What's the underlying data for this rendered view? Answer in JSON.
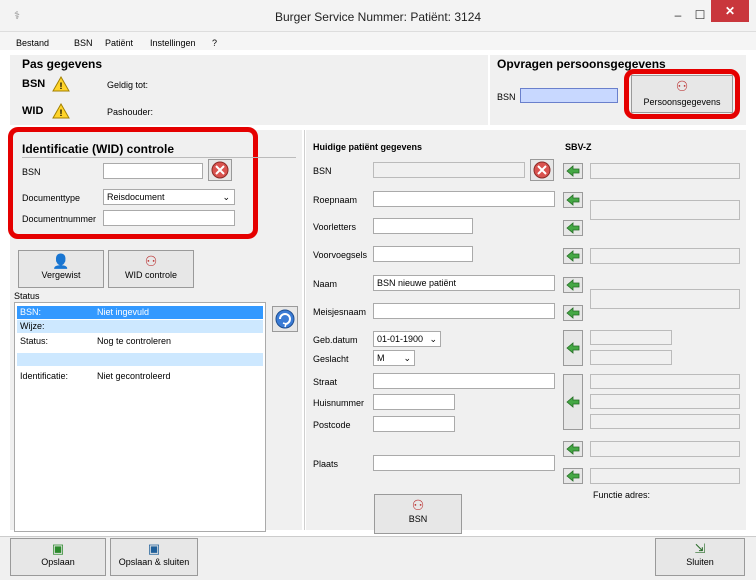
{
  "window": {
    "title": "Burger Service Nummer: Patiënt: 3124"
  },
  "menu": {
    "items": [
      "Bestand",
      "BSN",
      "Patiënt",
      "Instellingen",
      "?"
    ]
  },
  "pas": {
    "title": "Pas gegevens",
    "bsn_label": "BSN",
    "wid_label": "WID",
    "geldig": "Geldig tot:",
    "pashouder": "Pashouder:"
  },
  "opvragen": {
    "title": "Opvragen persoonsgegevens",
    "bsn_label": "BSN",
    "button": "Persoonsgegevens"
  },
  "wid": {
    "title": "Identificatie (WID) controle",
    "bsn_label": "BSN",
    "doctype_label": "Documenttype",
    "doctype_value": "Reisdocument",
    "docnum_label": "Documentnummer",
    "vergewist": "Vergewist",
    "controle": "WID controle"
  },
  "status": {
    "title": "Status",
    "rows": [
      {
        "label": "BSN:",
        "value": "Niet ingevuld"
      },
      {
        "label": "Wijze:",
        "value": ""
      },
      {
        "label": "Status:",
        "value": "Nog te controleren"
      },
      {
        "label": "",
        "value": ""
      },
      {
        "label": "Identificatie:",
        "value": "Niet gecontroleerd"
      }
    ]
  },
  "patient": {
    "title": "Huidige patiënt gegevens",
    "sbvz": "SBV-Z",
    "labels": {
      "bsn": "BSN",
      "roepnaam": "Roepnaam",
      "voorletters": "Voorletters",
      "voorvoegsels": "Voorvoegsels",
      "naam": "Naam",
      "meisjesnaam": "Meisjesnaam",
      "gebdatum": "Geb.datum",
      "geslacht": "Geslacht",
      "straat": "Straat",
      "huisnummer": "Huisnummer",
      "postcode": "Postcode",
      "plaats": "Plaats"
    },
    "naam_value": "BSN nieuwe patiënt",
    "gebdatum_value": "01-01-1900",
    "geslacht_value": "M",
    "functie": "Functie adres:",
    "bsn_button": "BSN"
  },
  "bottom": {
    "opslaan": "Opslaan",
    "opslaan_sluiten": "Opslaan & sluiten",
    "sluiten": "Sluiten"
  },
  "colors": {
    "selected_row": "#3399ff",
    "highlight_ring": "#e50000"
  }
}
